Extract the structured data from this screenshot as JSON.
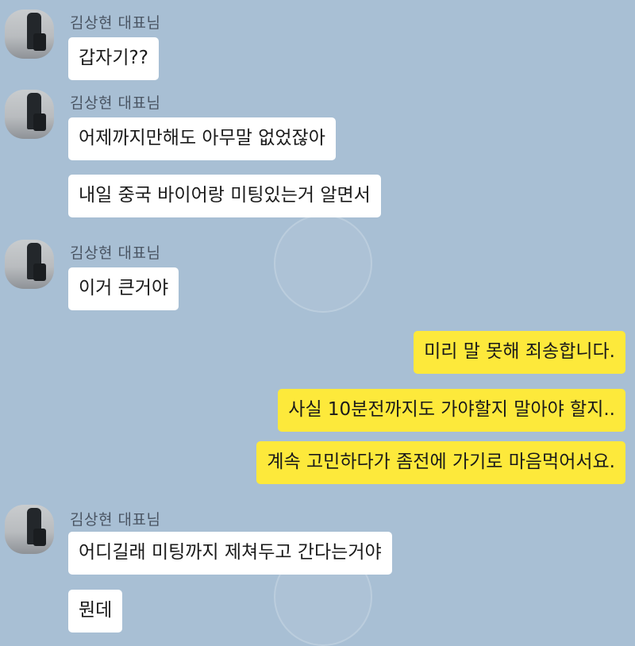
{
  "chat": {
    "sender_name": "김상현 대표님",
    "messages": [
      {
        "text": "갑자기??"
      },
      {
        "text": "어제까지만해도 아무말 없었잖아"
      },
      {
        "text": "내일 중국 바이어랑 미팅있는거 알면서"
      },
      {
        "text": "이거 큰거야"
      },
      {
        "text": "미리 말 못해 죄송합니다."
      },
      {
        "text": "사실 10분전까지도 가야할지 말아야 할지.."
      },
      {
        "text": "계속 고민하다가 좀전에 가기로 마음먹어서요."
      },
      {
        "text": "어디길래 미팅까지 제쳐두고 간다는거야"
      },
      {
        "text": "뭔데"
      }
    ]
  },
  "colors": {
    "background": "#a8bfd4",
    "incoming_bubble": "#ffffff",
    "outgoing_bubble": "#fde93b"
  }
}
